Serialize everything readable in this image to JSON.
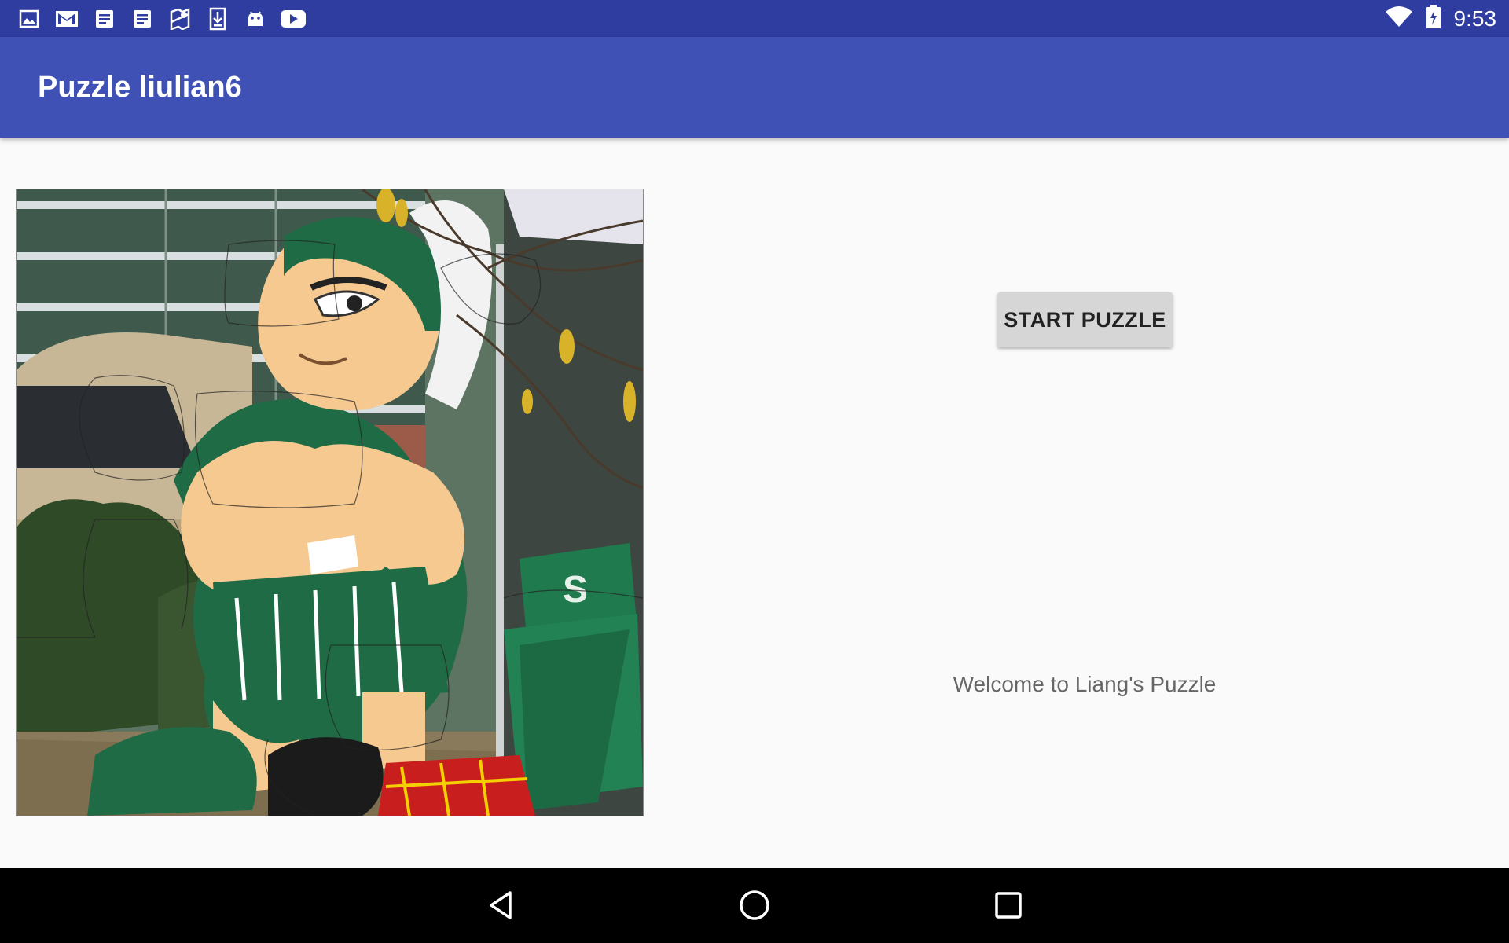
{
  "status_bar": {
    "time": "9:53",
    "notification_icons": [
      "image-icon",
      "gmail-icon",
      "document-icon",
      "document-icon",
      "maps-icon",
      "download-icon",
      "android-icon",
      "youtube-icon"
    ],
    "right_icons": [
      "wifi-icon",
      "battery-charging-icon"
    ]
  },
  "app_bar": {
    "title": "Puzzle liulian6",
    "color": "#3f51b5"
  },
  "main": {
    "puzzle_image_alt": "puzzle-image",
    "start_button_label": "START PUZZLE",
    "welcome_text": "Welcome to Liang's Puzzle"
  },
  "nav_bar": {
    "buttons": [
      "back-icon",
      "home-icon",
      "recents-icon"
    ]
  }
}
